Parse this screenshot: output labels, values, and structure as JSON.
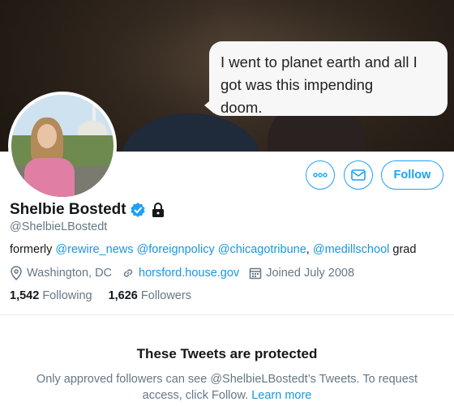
{
  "banner": {
    "bubble_line1": "I went to planet earth and all I",
    "bubble_line2": "got was this impending",
    "bubble_line3": "doom."
  },
  "actions": {
    "more_icon": "more-icon",
    "message_icon": "mail-icon",
    "follow_label": "Follow"
  },
  "profile": {
    "name": "Shelbie Bostedt",
    "handle": "@ShelbieLBostedt",
    "verified_icon": "verified-badge-icon",
    "protected_icon": "lock-icon",
    "bio": {
      "prefix": "formerly ",
      "mention1": "@rewire_news",
      "mention2": "@foreignpolicy",
      "mention3": "@chicagotribune",
      "comma": ",",
      "mention4": "@medillschool",
      "suffix": " grad"
    },
    "location": "Washington, DC",
    "website": "horsford.house.gov",
    "joined": "Joined July 2008"
  },
  "stats": {
    "following_count": "1,542",
    "following_label": "Following",
    "followers_count": "1,626",
    "followers_label": "Followers"
  },
  "protected": {
    "title": "These Tweets are protected",
    "text_line1": "Only approved followers can see @ShelbieLBostedt’s Tweets. To request",
    "text_line2": "access, click Follow. ",
    "learn_more": "Learn more"
  },
  "colors": {
    "accent": "#1da1f2",
    "link": "#1b95e0",
    "muted": "#657786"
  }
}
